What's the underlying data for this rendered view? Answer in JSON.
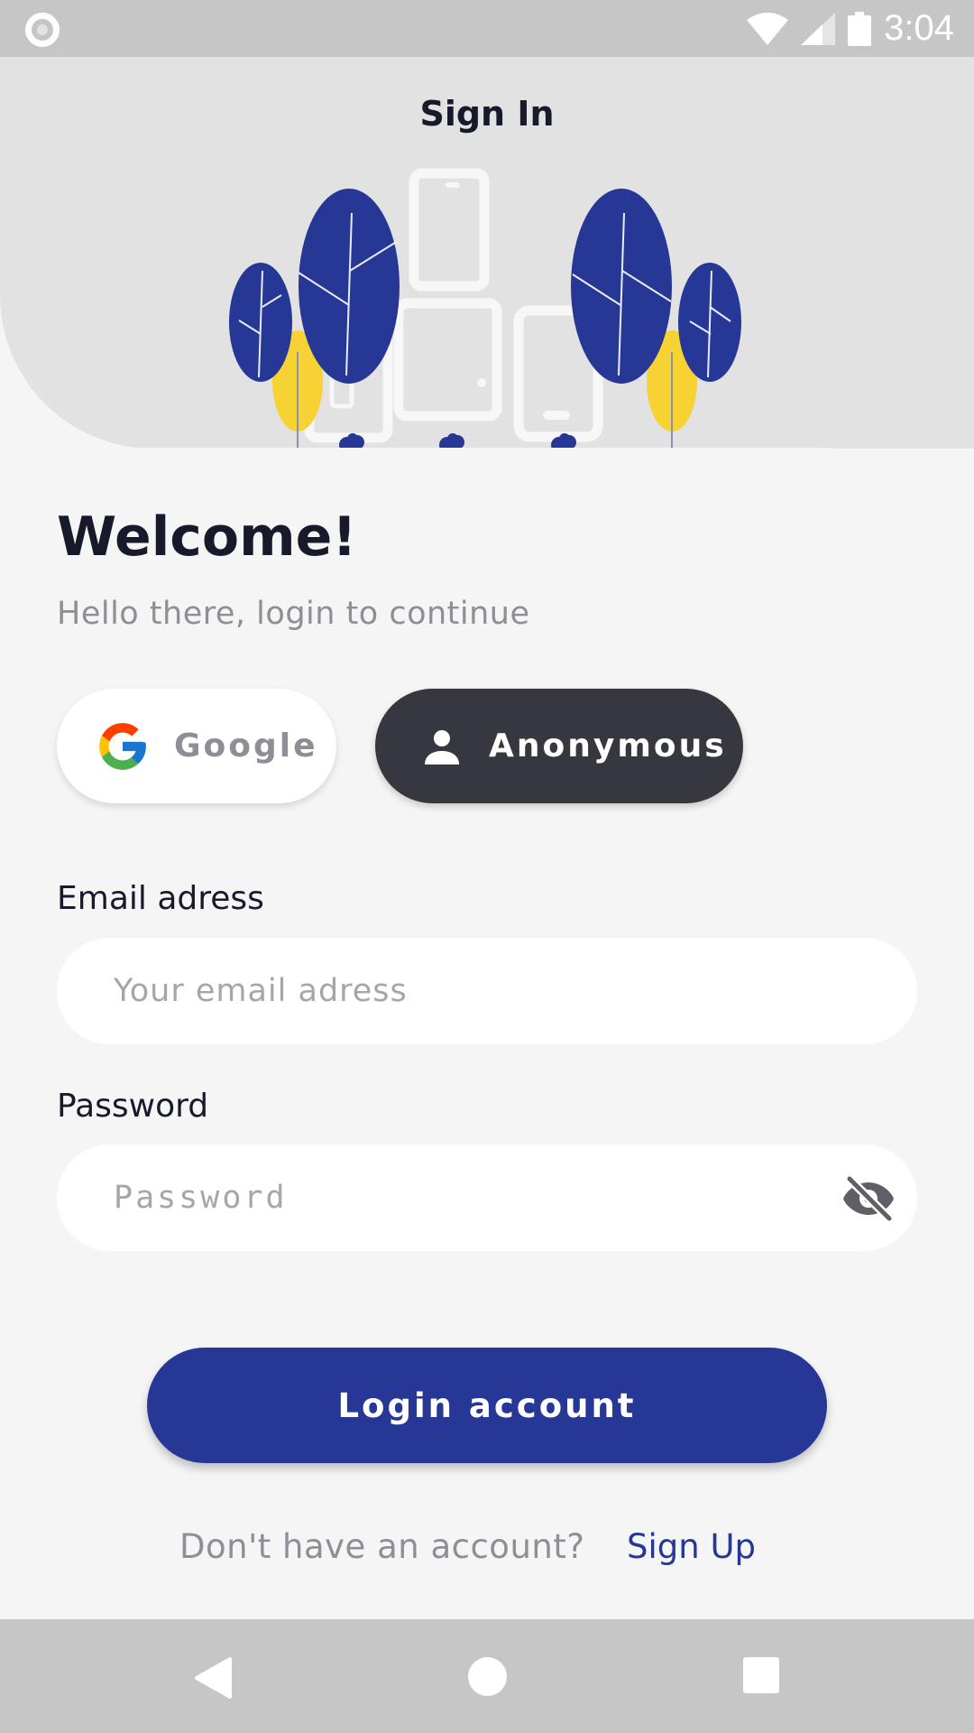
{
  "status_bar": {
    "time": "3:04"
  },
  "header": {
    "title": "Sign In"
  },
  "welcome": {
    "title": "Welcome!",
    "subtitle": "Hello there, login to continue"
  },
  "social": {
    "google_label": "Google",
    "anonymous_label": "Anonymous"
  },
  "email": {
    "label": "Email adress",
    "placeholder": "Your email adress"
  },
  "password": {
    "label": "Password",
    "placeholder": "Password"
  },
  "login_button": "Login account",
  "footer": {
    "question": "Don't have an account?",
    "signup_link": "Sign Up"
  },
  "colors": {
    "primary": "#263796",
    "dark_button": "#373740",
    "accent_yellow": "#f6d233",
    "text_dark": "#171a2b",
    "text_muted": "#8e8e96"
  },
  "icons": [
    "wifi-icon",
    "signal-icon",
    "battery-icon",
    "google-icon",
    "person-icon",
    "eye-off-icon",
    "back-icon",
    "home-icon",
    "recents-icon"
  ]
}
